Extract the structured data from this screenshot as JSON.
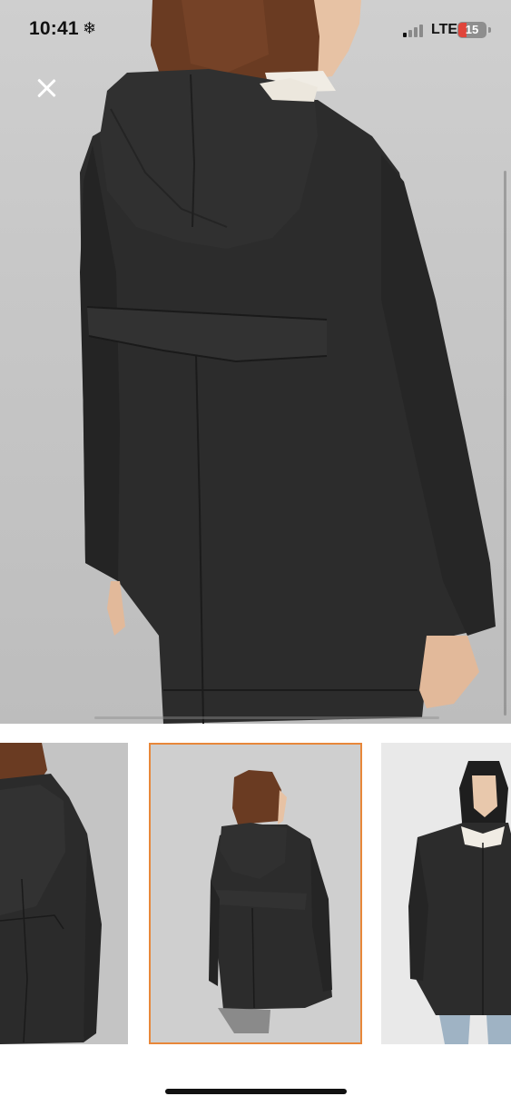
{
  "status_bar": {
    "time": "10:41",
    "focus_glyph": "❄",
    "network": "LTE",
    "battery_level": "15",
    "battery_color": "#e0453b"
  },
  "gallery": {
    "selected_index": 1,
    "selected_border_color": "#e8873a",
    "thumbnails": [
      {
        "icon": "jacket-side-view-image"
      },
      {
        "icon": "jacket-back-view-image"
      },
      {
        "icon": "jacket-front-view-image"
      }
    ]
  }
}
